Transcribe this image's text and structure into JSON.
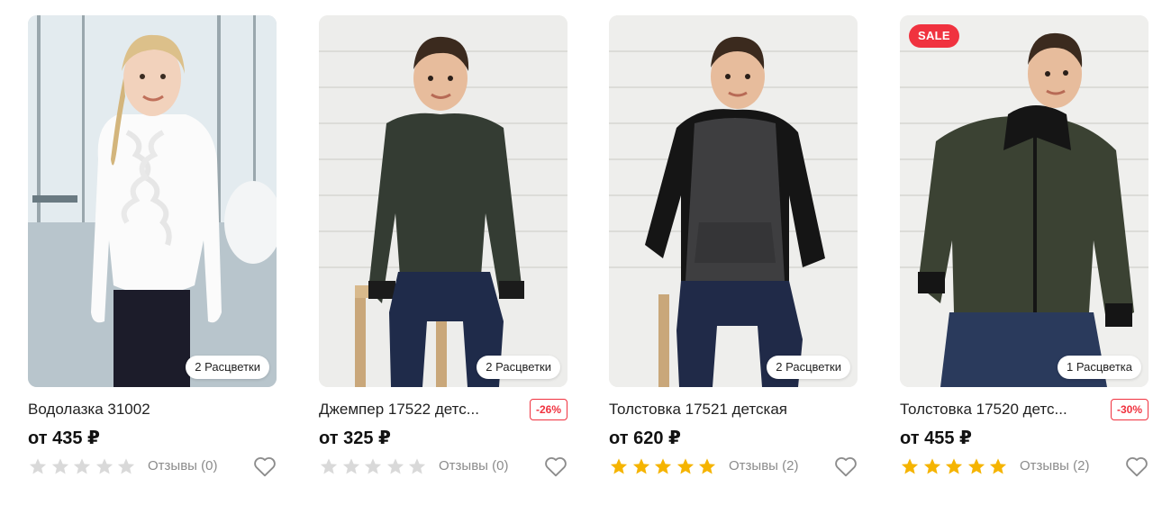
{
  "products": [
    {
      "title": "Водолазка 31002",
      "price": "от 435 ₽",
      "discount": "",
      "sale_label": "",
      "colors_label": "2 Расцветки",
      "rating_value": 0,
      "reviews_label": "Отзывы (0)",
      "image": "girl-white-ruffle-blouse"
    },
    {
      "title": "Джемпер 17522 детс...",
      "price": "от 325 ₽",
      "discount": "-26%",
      "sale_label": "",
      "colors_label": "2 Расцветки",
      "rating_value": 0,
      "reviews_label": "Отзывы (0)",
      "image": "boy-dark-green-sweater"
    },
    {
      "title": "Толстовка 17521 детская",
      "price": "от 620 ₽",
      "discount": "",
      "sale_label": "",
      "colors_label": "2 Расцветки",
      "rating_value": 5,
      "reviews_label": "Отзывы (2)",
      "image": "boy-grey-black-hoodie"
    },
    {
      "title": "Толстовка 17520 детс...",
      "price": "от 455 ₽",
      "discount": "-30%",
      "sale_label": "SALE",
      "colors_label": "1 Расцветка",
      "rating_value": 5,
      "reviews_label": "Отзывы (2)",
      "image": "boy-green-zip-hoodie"
    }
  ],
  "icons": {
    "star": "star-icon",
    "favorite": "heart-outline-icon"
  },
  "colors": {
    "sale": "#f0323f",
    "star_filled": "#f5b400",
    "star_empty": "#d9d9d9",
    "reviews_text": "#8b8b8b"
  }
}
